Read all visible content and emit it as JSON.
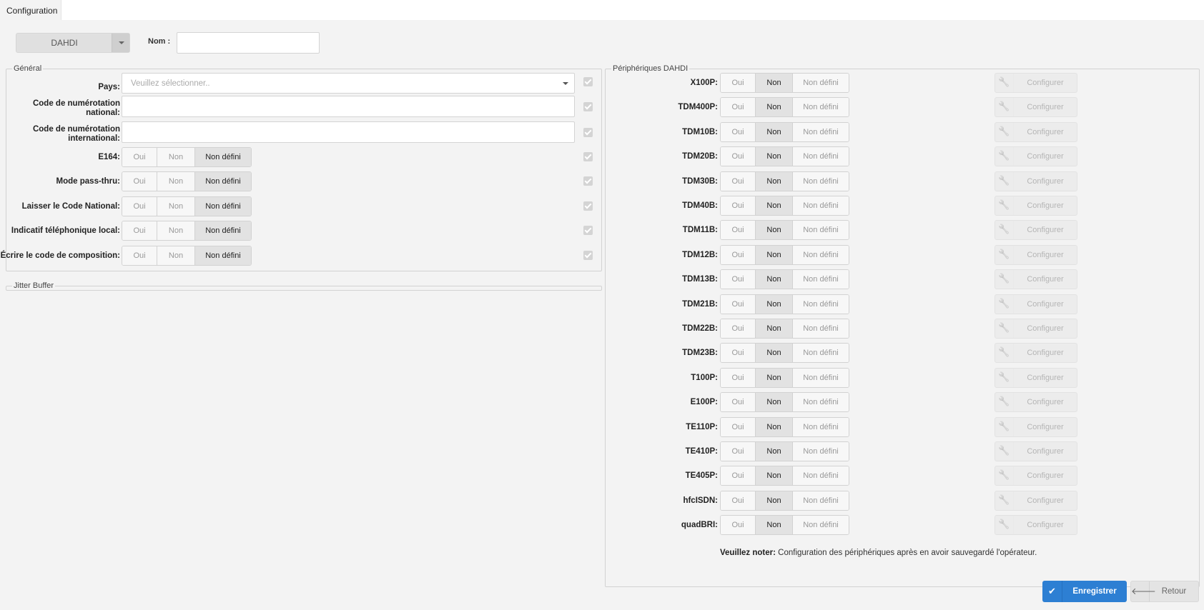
{
  "tabs": [
    {
      "label": "Configuration"
    }
  ],
  "top": {
    "type_select": "DAHDI",
    "name_label": "Nom :",
    "name_value": ""
  },
  "general": {
    "legend": "Général",
    "country_label": "Pays:",
    "country_placeholder": "Veuillez sélectionner..",
    "national_label_1": "Code de numérotation",
    "national_label_2": "national:",
    "international_label_1": "Code de numérotation",
    "international_label_2": "international:",
    "toggle_rows": [
      {
        "label": "E164:",
        "selected": "Non défini"
      },
      {
        "label": "Mode pass-thru:",
        "selected": "Non défini"
      },
      {
        "label": "Laisser le Code National:",
        "selected": "Non défini"
      },
      {
        "label": "Indicatif téléphonique local:",
        "selected": "Non défini"
      },
      {
        "label": "Écrire le code de composition:",
        "selected": "Non défini"
      }
    ]
  },
  "options": {
    "yes": "Oui",
    "no": "Non",
    "undefined": "Non défini"
  },
  "jitter": {
    "legend": "Jitter Buffer"
  },
  "devices": {
    "legend": "Périphériques DAHDI",
    "configure_label": "Configurer",
    "items": [
      {
        "label": "X100P:",
        "selected": "Non"
      },
      {
        "label": "TDM400P:",
        "selected": "Non"
      },
      {
        "label": "TDM10B:",
        "selected": "Non"
      },
      {
        "label": "TDM20B:",
        "selected": "Non"
      },
      {
        "label": "TDM30B:",
        "selected": "Non"
      },
      {
        "label": "TDM40B:",
        "selected": "Non"
      },
      {
        "label": "TDM11B:",
        "selected": "Non"
      },
      {
        "label": "TDM12B:",
        "selected": "Non"
      },
      {
        "label": "TDM13B:",
        "selected": "Non"
      },
      {
        "label": "TDM21B:",
        "selected": "Non"
      },
      {
        "label": "TDM22B:",
        "selected": "Non"
      },
      {
        "label": "TDM23B:",
        "selected": "Non"
      },
      {
        "label": "T100P:",
        "selected": "Non"
      },
      {
        "label": "E100P:",
        "selected": "Non"
      },
      {
        "label": "TE110P:",
        "selected": "Non"
      },
      {
        "label": "TE410P:",
        "selected": "Non"
      },
      {
        "label": "TE405P:",
        "selected": "Non"
      },
      {
        "label": "hfcISDN:",
        "selected": "Non"
      },
      {
        "label": "quadBRI:",
        "selected": "Non"
      }
    ],
    "note_bold": "Veuillez noter:",
    "note_text": " Configuration des périphériques après en avoir sauvegardé l'opérateur."
  },
  "actions": {
    "save": "Enregistrer",
    "back": "Retour"
  },
  "colors": {
    "primary": "#2d7fd3",
    "panel_bg": "#f3f3f3",
    "active_toggle": "#e2e2e2"
  },
  "icons": {
    "save": "check-icon",
    "back": "arrow-left-icon",
    "configure": "wrench-icon"
  }
}
